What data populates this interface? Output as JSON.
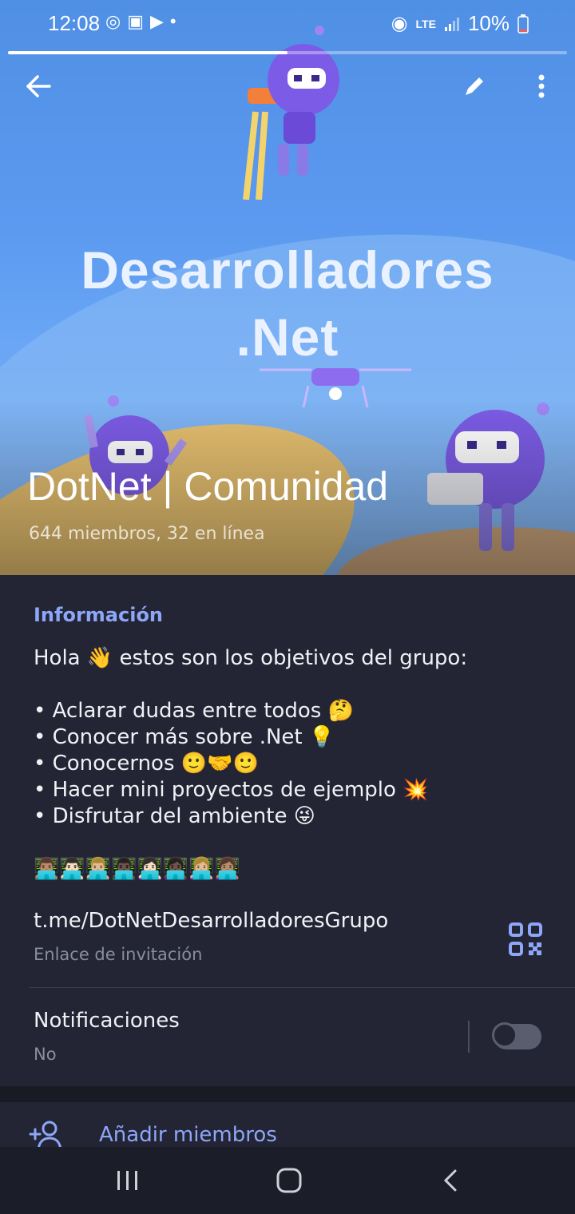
{
  "status_bar": {
    "time": "12:08",
    "notification_icons": [
      "signal-app-icon",
      "instagram-icon",
      "youtube-icon",
      "dot-icon"
    ],
    "network": "LTE",
    "battery": "10%"
  },
  "story_progress": 0.5,
  "header": {
    "banner_title_line1": "Desarrolladores",
    "banner_title_line2": ".Net",
    "group_name": "DotNet | Comunidad",
    "group_subtitle": "644 miembros, 32 en línea"
  },
  "info": {
    "section_label": "Información",
    "about_text": "Hola 👋 estos son los objetivos del grupo:\n\n• Aclarar dudas entre todos 🤔\n• Conocer más sobre .Net 💡\n• Conocernos 🙂🤝🙂\n• Hacer mini proyectos de ejemplo 💥\n• Disfrutar del ambiente 😜\n\n👨🏽‍💻👨🏻‍💻👨🏼‍💻👨🏿‍💻👩🏻‍💻👩🏿‍💻👩🏼‍💻👩🏽‍💻",
    "link": "t.me/DotNetDesarrolladoresGrupo",
    "link_caption": "Enlace de invitación",
    "notifications_label": "Notificaciones",
    "notifications_value": "No"
  },
  "actions": {
    "add_members": "Añadir miembros"
  },
  "colors": {
    "accent": "#8ea6f7",
    "panel": "#232535",
    "background": "#1d1f2b"
  }
}
